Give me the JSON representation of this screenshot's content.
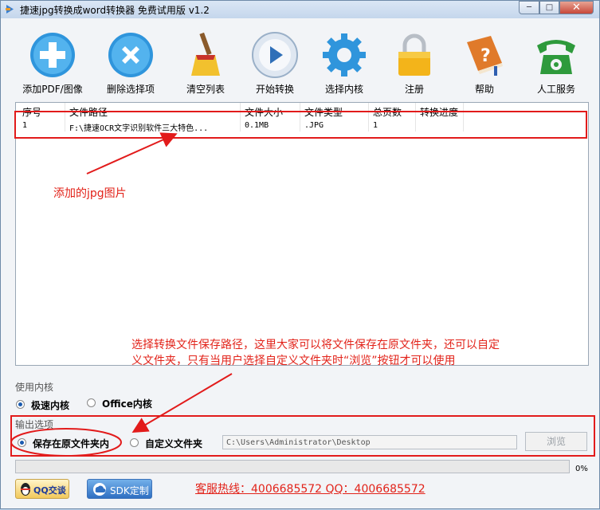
{
  "window": {
    "title": "捷速jpg转换成word转换器 免费试用版 v1.2",
    "min_label": "─",
    "max_label": "□",
    "close_label": "✕"
  },
  "toolbar": [
    {
      "label": "添加PDF/图像",
      "icon": "add-icon"
    },
    {
      "label": "删除选择项",
      "icon": "delete-icon"
    },
    {
      "label": "清空列表",
      "icon": "broom-icon"
    },
    {
      "label": "开始转换",
      "icon": "play-icon"
    },
    {
      "label": "选择内核",
      "icon": "gear-icon"
    },
    {
      "label": "注册",
      "icon": "lock-icon"
    },
    {
      "label": "帮助",
      "icon": "help-book-icon"
    },
    {
      "label": "人工服务",
      "icon": "phone-icon"
    }
  ],
  "file_list": {
    "columns": [
      "序号",
      "文件路径",
      "文件大小",
      "文件类型",
      "总页数",
      "转换进度"
    ],
    "rows": [
      {
        "index": "1",
        "path": "F:\\捷速OCR文字识别软件三大特色...",
        "size": "0.1MB",
        "type": ".JPG",
        "pages": "1",
        "progress": ""
      }
    ]
  },
  "annotations": {
    "added_image": "添加的jpg图片",
    "save_path_note_line1": "选择转换文件保存路径，这里大家可以将文件保存在原文件夹，还可以自定",
    "save_path_note_line2": "义文件夹，只有当用户选择自定义文件夹时“浏览”按钮才可以使用"
  },
  "engine": {
    "label": "使用内核",
    "options": [
      "极速内核",
      "Office内核"
    ],
    "selected": 0
  },
  "output": {
    "label": "输出选项",
    "options": [
      "保存在原文件夹内",
      "自定义文件夹"
    ],
    "selected": 0,
    "path_value": "C:\\Users\\Administrator\\Desktop",
    "browse_label": "浏览"
  },
  "progress": {
    "value": 0,
    "label": "0%"
  },
  "footer": {
    "qq_label": "QQ交谈",
    "sdk_label": "SDK定制",
    "hotline": "客服热线：4006685572 QQ：4006685572"
  },
  "colors": {
    "annotation_red": "#e2231a",
    "accent_blue": "#2e8fd8"
  }
}
